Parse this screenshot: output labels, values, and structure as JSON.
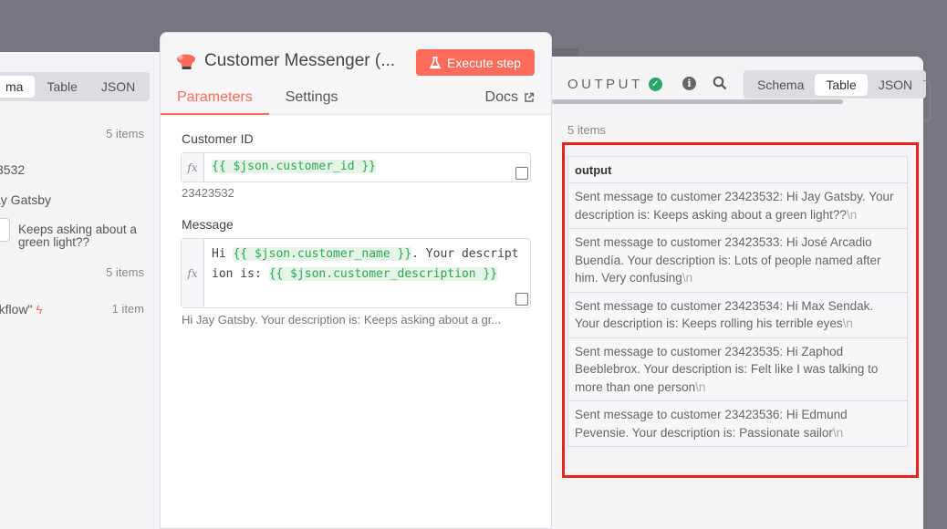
{
  "left": {
    "tabs": [
      "ma",
      "Table",
      "JSON"
    ],
    "active_tab": 0,
    "count1": "5 items",
    "frag_id": "3532",
    "frag_name": "ay Gatsby",
    "desc": "Keeps asking about a green light??",
    "count2": "5 items",
    "workflow": "rkflow\"",
    "workflow_count": "1 item"
  },
  "node": {
    "title": "Customer Messenger (...",
    "execute_label": "Execute step",
    "tabs": [
      "Parameters",
      "Settings"
    ],
    "docs_label": "Docs",
    "fx": "fx",
    "customer_id_label": "Customer ID",
    "customer_id_expr": "{{ $json.customer_id }}",
    "customer_id_result": "23423532",
    "message_label": "Message",
    "message_expr_pre": "Hi ",
    "message_expr_tok1": "{{ $json.customer_name }}",
    "message_expr_mid": ". Your description is: ",
    "message_expr_tok2": "{{ $json.customer_description }}",
    "message_result": "Hi Jay Gatsby. Your description is: Keeps asking about a gr..."
  },
  "output": {
    "title": "OUTPUT",
    "tabs": [
      "Schema",
      "Table",
      "JSON"
    ],
    "count": "5 items",
    "column": "output",
    "newline_marker": "\\n",
    "rows": [
      "Sent message to customer 23423532:  Hi Jay Gatsby. Your description is: Keeps asking about a green light??",
      "Sent message to customer 23423533:  Hi José Arcadio Buendía. Your description is: Lots of people named after him. Very confusing",
      "Sent message to customer 23423534:  Hi Max Sendak. Your description is: Keeps rolling his terrible eyes",
      "Sent message to customer 23423535:  Hi Zaphod Beeblebrox. Your description is: Felt like I was talking to more than one person",
      "Sent message to customer 23423536:  Hi Edmund Pevensie. Your description is: Passionate sailor"
    ]
  },
  "colors": {
    "accent": "#ff6d5a",
    "success": "#29a568",
    "token_bg": "#e5f4e8",
    "token_fg": "#2da94f",
    "highlight": "#e8221c"
  }
}
